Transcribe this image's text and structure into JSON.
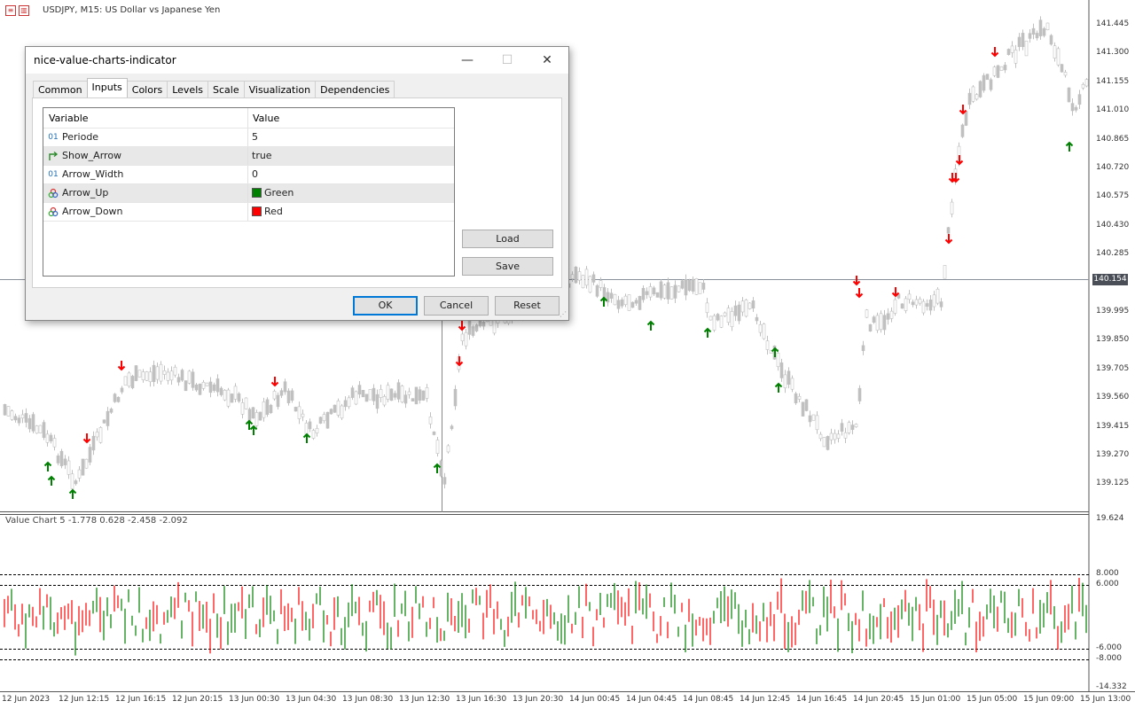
{
  "chart": {
    "title": "USDJPY, M15:  US Dollar vs Japanese Yen",
    "current_price": "140.154",
    "price_axis": [
      "141.445",
      "141.300",
      "141.155",
      "141.010",
      "140.865",
      "140.720",
      "140.575",
      "140.430",
      "140.285",
      "139.995",
      "139.850",
      "139.705",
      "139.560",
      "139.415",
      "139.270",
      "139.125"
    ],
    "time_axis": [
      "12 Jun 2023",
      "12 Jun 12:15",
      "12 Jun 16:15",
      "12 Jun 20:15",
      "13 Jun 00:30",
      "13 Jun 04:30",
      "13 Jun 08:30",
      "13 Jun 12:30",
      "13 Jun 16:30",
      "13 Jun 20:30",
      "14 Jun 00:45",
      "14 Jun 04:45",
      "14 Jun 08:45",
      "14 Jun 12:45",
      "14 Jun 16:45",
      "14 Jun 20:45",
      "15 Jun 01:00",
      "15 Jun 05:00",
      "15 Jun 09:00",
      "15 Jun 13:00"
    ]
  },
  "subwindow": {
    "title": "Value Chart 5 -1.778 0.628 -2.458 -2.092",
    "axis_top": "19.624",
    "axis_bottom": "-14.332",
    "levels": [
      "8.000",
      "6.000",
      "-6.000",
      "-8.000"
    ]
  },
  "colors": {
    "candle": "#c0c0c0",
    "arrow_up": "#008000",
    "arrow_down": "#ff0000",
    "vc_up": "#008000",
    "vc_down": "#ff0000",
    "vc_extreme": "#0000ff"
  },
  "dialog": {
    "title": "nice-value-charts-indicator",
    "tabs": [
      {
        "label": "Common"
      },
      {
        "label": "Inputs"
      },
      {
        "label": "Colors"
      },
      {
        "label": "Levels"
      },
      {
        "label": "Scale"
      },
      {
        "label": "Visualization"
      },
      {
        "label": "Dependencies"
      }
    ],
    "active_tab": "Inputs",
    "grid_headers": {
      "variable": "Variable",
      "value": "Value"
    },
    "inputs": [
      {
        "icon": "01",
        "variable": "Periode",
        "value": "5"
      },
      {
        "icon": "bool",
        "variable": "Show_Arrow",
        "value": "true"
      },
      {
        "icon": "01",
        "variable": "Arrow_Width",
        "value": "0"
      },
      {
        "icon": "color",
        "variable": "Arrow_Up",
        "value": "Green",
        "swatch": "#008000"
      },
      {
        "icon": "color",
        "variable": "Arrow_Down",
        "value": "Red",
        "swatch": "#ff0000"
      }
    ],
    "load_label": "Load",
    "save_label": "Save",
    "ok_label": "OK",
    "cancel_label": "Cancel",
    "reset_label": "Reset",
    "minimize": "—",
    "maximize": "☐",
    "close": "✕"
  }
}
